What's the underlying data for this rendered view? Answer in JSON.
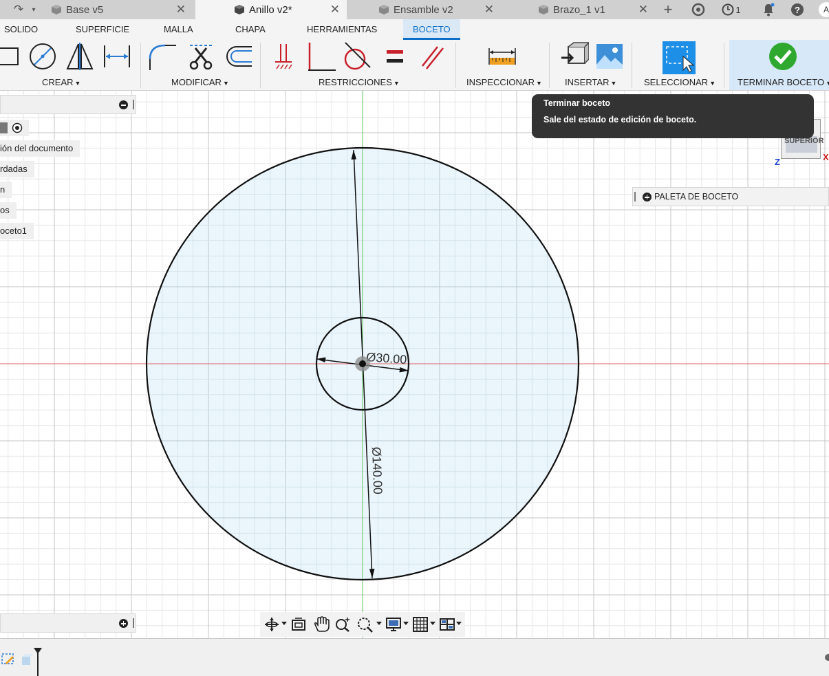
{
  "document_tabs": [
    {
      "label": "Base v5",
      "active": false
    },
    {
      "label": "Anillo v2*",
      "active": true
    },
    {
      "label": "Ensamble v2",
      "active": false
    },
    {
      "label": "Brazo_1 v1",
      "active": false
    }
  ],
  "toolbar_right": {
    "job_count": "1",
    "user_initial": "A"
  },
  "workspace_tabs": [
    "SOLIDO",
    "SUPERFICIE",
    "MALLA",
    "CHAPA",
    "HERRAMIENTAS",
    "BOCETO"
  ],
  "active_workspace": "BOCETO",
  "ribbon_groups": {
    "crear": "CREAR",
    "modificar": "MODIFICAR",
    "restricciones": "RESTRICCIONES",
    "inspeccionar": "INSPECCIONAR",
    "insertar": "INSERTAR",
    "seleccionar": "SELECCIONAR",
    "terminar": "TERMINAR BOCETO"
  },
  "browser": {
    "items": [
      "ión del documento",
      "rdadas",
      "n",
      "os",
      "oceto1"
    ]
  },
  "tooltip": {
    "title": "Terminar boceto",
    "description": "Sale del estado de edición de boceto."
  },
  "viewcube": {
    "face": "SUPERIOR",
    "axis_z": "Z",
    "axis_x": "X"
  },
  "sketch_palette": {
    "label": "PALETA DE BOCETO"
  },
  "sketch": {
    "outer_diameter_label": "Ø140.00",
    "inner_diameter_label": "Ø30.00",
    "fill_color": "#e8f4fb",
    "axis_x_color": "#e06464",
    "axis_y_color": "#5fc45f"
  },
  "colors": {
    "accent": "#0b6fc7",
    "finish_green": "#2fa82f"
  }
}
